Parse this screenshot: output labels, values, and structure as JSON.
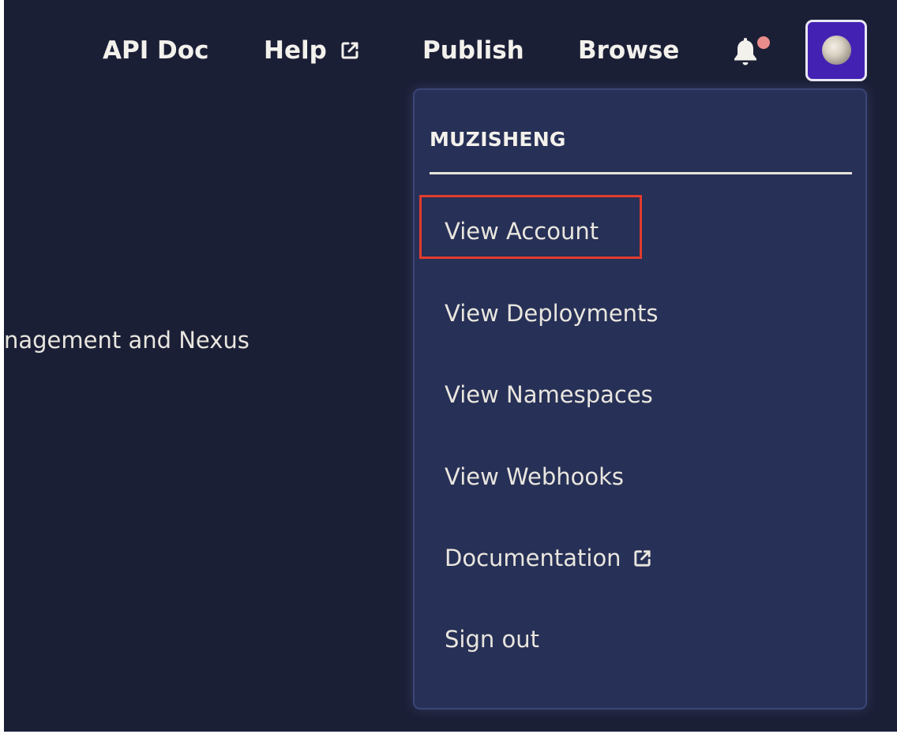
{
  "nav": {
    "api_doc": "API Doc",
    "help": "Help",
    "publish": "Publish",
    "browse": "Browse",
    "help_icon": "external-link-icon",
    "bell_icon": "bell-icon"
  },
  "background": {
    "text": "nagement and Nexus"
  },
  "dropdown": {
    "username": "MUZISHENG",
    "items": [
      {
        "label": "View Account"
      },
      {
        "label": "View Deployments"
      },
      {
        "label": "View Namespaces"
      },
      {
        "label": "View Webhooks"
      },
      {
        "label": "Documentation",
        "icon": "external-link-icon"
      },
      {
        "label": "Sign out"
      }
    ]
  },
  "colors": {
    "background": "#1b1f36",
    "dropdown": "#273056",
    "avatar_button": "#4322b3",
    "notification_dot": "#e98c8c",
    "highlight": "#e23b2e"
  }
}
